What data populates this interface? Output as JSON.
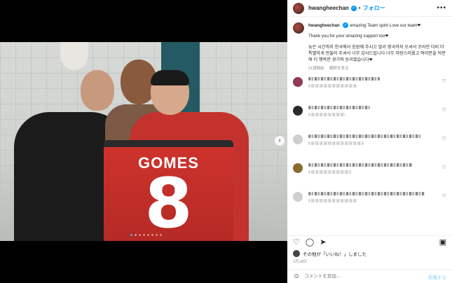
{
  "header": {
    "username": "hwangheechan",
    "separator": "•",
    "follow_label": "フォロー",
    "more_label": "•••"
  },
  "caption": {
    "username": "hwangheechan",
    "text": "amazing Team spirit Love our team❤",
    "line2": "Thank you for your amazing support too❤",
    "line3": "늦은 시간까지 한국에서 응원해 주시고 멀리 영국까지 오셔서 코리안 더비 더 특별하게 만들어 주셔서 너무 감사드립니다 너무 자랑스러웠고 여러분을 덕분에 더 행복한 경기와 승리였습니다❤",
    "age": "21週間前",
    "translate_label": "翻訳を見る"
  },
  "photo": {
    "jersey_name": "GOMES",
    "jersey_number": "8",
    "next_icon": "chevron-right-icon",
    "slide_count": 8,
    "active_slide": 1
  },
  "comments": [
    {
      "avatar_color": "#8e3b55",
      "lines": 2
    },
    {
      "avatar_color": "#2b2b2b",
      "lines": 2
    },
    {
      "avatar_color": "#cfcfcf",
      "lines": 2
    },
    {
      "avatar_color": "#8c6a2e",
      "lines": 2
    },
    {
      "avatar_color": "#cfcfcf",
      "lines": 2
    }
  ],
  "actions": {
    "like_icon": "heart-icon",
    "comment_icon": "comment-icon",
    "share_icon": "send-icon",
    "save_icon": "bookmark-icon"
  },
  "likes_text": "その他が「いいね！」しました",
  "date": "2月18日",
  "add_comment": {
    "placeholder": "コメントを追加...",
    "post_label": "投稿する"
  },
  "colors": {
    "accent": "#0095f6",
    "jersey": "#c4322e",
    "text": "#262626",
    "muted": "#8e8e8e"
  }
}
